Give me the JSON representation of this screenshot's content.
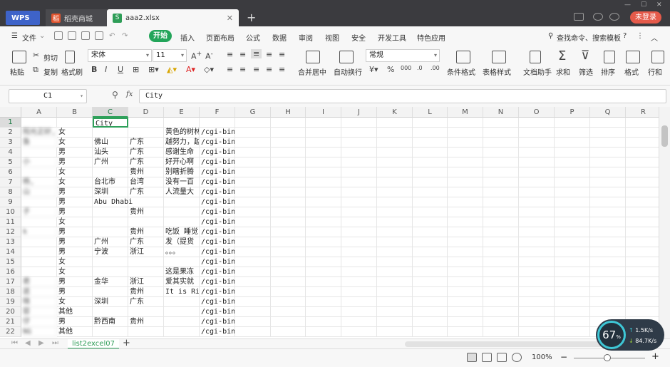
{
  "tabs": {
    "wps": "WPS",
    "shop": "稻壳商城",
    "file": "aaa2.xlsx",
    "login": "未登录"
  },
  "menu": {
    "file": "文件",
    "start": "开始",
    "items": [
      "插入",
      "页面布局",
      "公式",
      "数据",
      "审阅",
      "视图",
      "安全",
      "开发工具",
      "特色应用"
    ],
    "search": "查找命令、搜索模板"
  },
  "ribbon": {
    "paste": "粘贴",
    "cut": "剪切",
    "copy": "复制",
    "format_painter": "格式刷",
    "font_name": "宋体",
    "font_size": "11",
    "merge_center": "合并居中",
    "wrap_text": "自动换行",
    "number_format": "常规",
    "cond_format": "条件格式",
    "table_style": "表格样式",
    "doc_helper": "文档助手",
    "sum": "求和",
    "filter": "筛选",
    "sort": "排序",
    "format": "格式",
    "rows_cols": "行和"
  },
  "formula_bar": {
    "cell_ref": "C1",
    "fx": "fx",
    "value": "City"
  },
  "columns": [
    "A",
    "B",
    "C",
    "D",
    "E",
    "F",
    "G",
    "H",
    "I",
    "J",
    "K",
    "L",
    "M",
    "N",
    "O",
    "P",
    "Q",
    "R"
  ],
  "rows": [
    {
      "n": "1",
      "a": "",
      "b": "",
      "c": "City",
      "d": "",
      "e": "",
      "f": ""
    },
    {
      "n": "2",
      "a": "阳光正好,",
      "b": "女",
      "c": "",
      "d": "",
      "e": "黄色的树林",
      "f": "/cgi-bin/None"
    },
    {
      "n": "3",
      "a": "鱼",
      "b": "女",
      "c": "佛山",
      "d": "广东",
      "e": "越努力，越",
      "f": "/cgi-bin/None"
    },
    {
      "n": "4",
      "a": "",
      "b": "男",
      "c": "汕头",
      "d": "广东",
      "e": "感谢生命",
      "f": "/cgi-bin/None"
    },
    {
      "n": "5",
      "a": "小",
      "b": "男",
      "c": "广州",
      "d": "广东",
      "e": "好开心啊",
      "f": "/cgi-bin/None"
    },
    {
      "n": "6",
      "a": "",
      "b": "女",
      "c": "",
      "d": "贵州",
      "e": "别瞎折腾",
      "f": "/cgi-bin/None"
    },
    {
      "n": "7",
      "a": "杨,",
      "b": "女",
      "c": "台北市",
      "d": "台湾",
      "e": "没有一百",
      "f": "/cgi-bin/None"
    },
    {
      "n": "8",
      "a": "山",
      "b": "男",
      "c": "深圳",
      "d": "广东",
      "e": "人流量大",
      "f": "/cgi-bin/None"
    },
    {
      "n": "9",
      "a": "",
      "b": "男",
      "c": "Abu Dhabi",
      "d": "",
      "e": "",
      "f": "/cgi-bin/None"
    },
    {
      "n": "10",
      "a": "子",
      "b": "男",
      "c": "",
      "d": "贵州",
      "e": "",
      "f": "/cgi-bin/None"
    },
    {
      "n": "11",
      "a": "",
      "b": "女",
      "c": "",
      "d": "",
      "e": "",
      "f": "/cgi-bin/None"
    },
    {
      "n": "12",
      "a": "k",
      "b": "男",
      "c": "",
      "d": "贵州",
      "e": "吃饭 睡觉",
      "f": "/cgi-bin/None"
    },
    {
      "n": "13",
      "a": "",
      "b": "男",
      "c": "广州",
      "d": "广东",
      "e": "发（提货",
      "f": "/cgi-bin/None"
    },
    {
      "n": "14",
      "a": "",
      "b": "男",
      "c": "宁波",
      "d": "浙江",
      "e": "。。。",
      "f": "/cgi-bin/None"
    },
    {
      "n": "15",
      "a": "",
      "b": "女",
      "c": "",
      "d": "",
      "e": "",
      "f": "/cgi-bin/None"
    },
    {
      "n": "16",
      "a": "",
      "b": "女",
      "c": "",
      "d": "",
      "e": "这是果冻",
      "f": "/cgi-bin/None"
    },
    {
      "n": "17",
      "a": "君",
      "b": "男",
      "c": "金华",
      "d": "浙江",
      "e": "爱其实就",
      "f": "/cgi-bin/None"
    },
    {
      "n": "18",
      "a": "逝",
      "b": "男",
      "c": "",
      "d": "贵州",
      "e": "It is Ri",
      "f": "/cgi-bin/None"
    },
    {
      "n": "19",
      "a": "晓",
      "b": "女",
      "c": "深圳",
      "d": "广东",
      "e": "",
      "f": "/cgi-bin/None"
    },
    {
      "n": "20",
      "a": "容",
      "b": "其他",
      "c": "",
      "d": "",
      "e": "",
      "f": "/cgi-bin/None"
    },
    {
      "n": "21",
      "a": "仔",
      "b": "男",
      "c": "黔西南",
      "d": "贵州",
      "e": "",
      "f": "/cgi-bin/None"
    },
    {
      "n": "22",
      "a": "NG",
      "b": "其他",
      "c": "",
      "d": "",
      "e": "",
      "f": "/cgi-bin/None"
    }
  ],
  "sheet_tab": "list2excel07",
  "status": {
    "zoom": "100%"
  },
  "widget": {
    "percent": "67",
    "up": "1.5K/s",
    "down": "84.7K/s"
  },
  "colors": {
    "accent": "#2ea05a",
    "tab_bar": "#3b3b3f",
    "login": "#e55a4a"
  }
}
